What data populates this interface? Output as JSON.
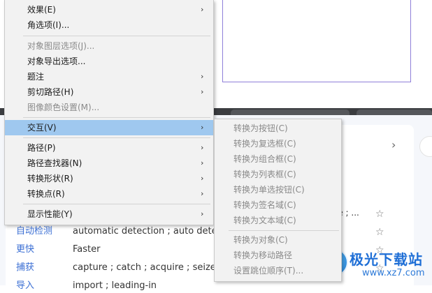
{
  "main_menu": {
    "items": [
      {
        "label": "效果(E)",
        "submenu": true,
        "disabled": false
      },
      {
        "label": "角选项(I)...",
        "submenu": false,
        "disabled": false
      },
      {
        "label": "对象图层选项(J)...",
        "submenu": false,
        "disabled": true
      },
      {
        "label": "对象导出选项...",
        "submenu": false,
        "disabled": false
      },
      {
        "label": "题注",
        "submenu": true,
        "disabled": false
      },
      {
        "label": "剪切路径(H)",
        "submenu": true,
        "disabled": false
      },
      {
        "label": "图像颜色设置(M)...",
        "submenu": false,
        "disabled": true
      },
      {
        "label": "交互(V)",
        "submenu": true,
        "disabled": false,
        "active": true
      },
      {
        "label": "路径(P)",
        "submenu": true,
        "disabled": false
      },
      {
        "label": "路径查找器(N)",
        "submenu": true,
        "disabled": false
      },
      {
        "label": "转换形状(R)",
        "submenu": true,
        "disabled": false
      },
      {
        "label": "转换点(R)",
        "submenu": true,
        "disabled": false
      },
      {
        "label": "显示性能(Y)",
        "submenu": true,
        "disabled": false
      }
    ],
    "arrow_glyph": "›"
  },
  "interact_submenu": {
    "items": [
      {
        "label": "转换为按钮(C)"
      },
      {
        "label": "转换为复选框(C)"
      },
      {
        "label": "转换为组合框(C)"
      },
      {
        "label": "转换为列表框(C)"
      },
      {
        "label": "转换为单选按钮(C)"
      },
      {
        "label": "转换为签名域(C)"
      },
      {
        "label": "转换为文本域(C)"
      },
      {
        "label": "转换为对象(C)"
      },
      {
        "label": "转换为移动路径"
      },
      {
        "label": "设置跳位顺序(T)..."
      }
    ]
  },
  "background": {
    "chevron": "›",
    "partial_text": "le ; ...",
    "dictionary_rows": [
      {
        "term": "自动检测",
        "translation": "automatic detection ; auto detec"
      },
      {
        "term": "更快",
        "translation": "Faster"
      },
      {
        "term": "捕获",
        "translation": "capture ; catch ; acquire ; seize ; suc"
      },
      {
        "term": "导入",
        "translation": "import ; leading-in"
      }
    ],
    "star_glyph": "☆",
    "watermark": {
      "title": "极光下载站",
      "url": "www.xz7.com"
    }
  },
  "colors": {
    "menu_bg": "#f2f2f2",
    "highlight": "#9fc8ef",
    "disabled_text": "#8a8a8a",
    "link_blue": "#3b6fd4",
    "artboard_border": "#8f7fd9"
  }
}
